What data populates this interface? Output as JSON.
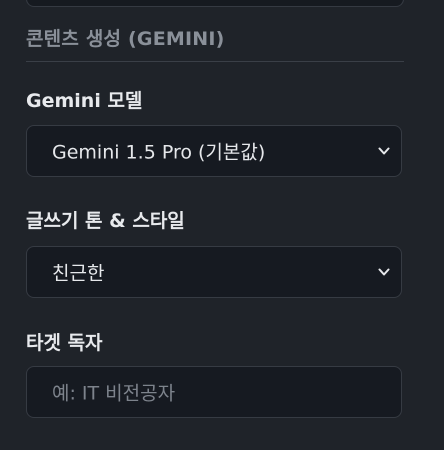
{
  "section": {
    "title": "콘텐츠 생성 (GEMINI)"
  },
  "model": {
    "label": "Gemini 모델",
    "selected": "Gemini 1.5 Pro (기본값)"
  },
  "tone": {
    "label": "글쓰기 톤 & 스타일",
    "selected": "친근한"
  },
  "target": {
    "label": "타겟 독자",
    "placeholder": "예: IT 비전공자",
    "value": ""
  },
  "icons": {
    "select_arrow": "chevron-down-icon"
  },
  "colors": {
    "background": "#1f2329",
    "control_background": "#161a21",
    "control_border": "#363b43",
    "section_title": "#8a9099"
  }
}
